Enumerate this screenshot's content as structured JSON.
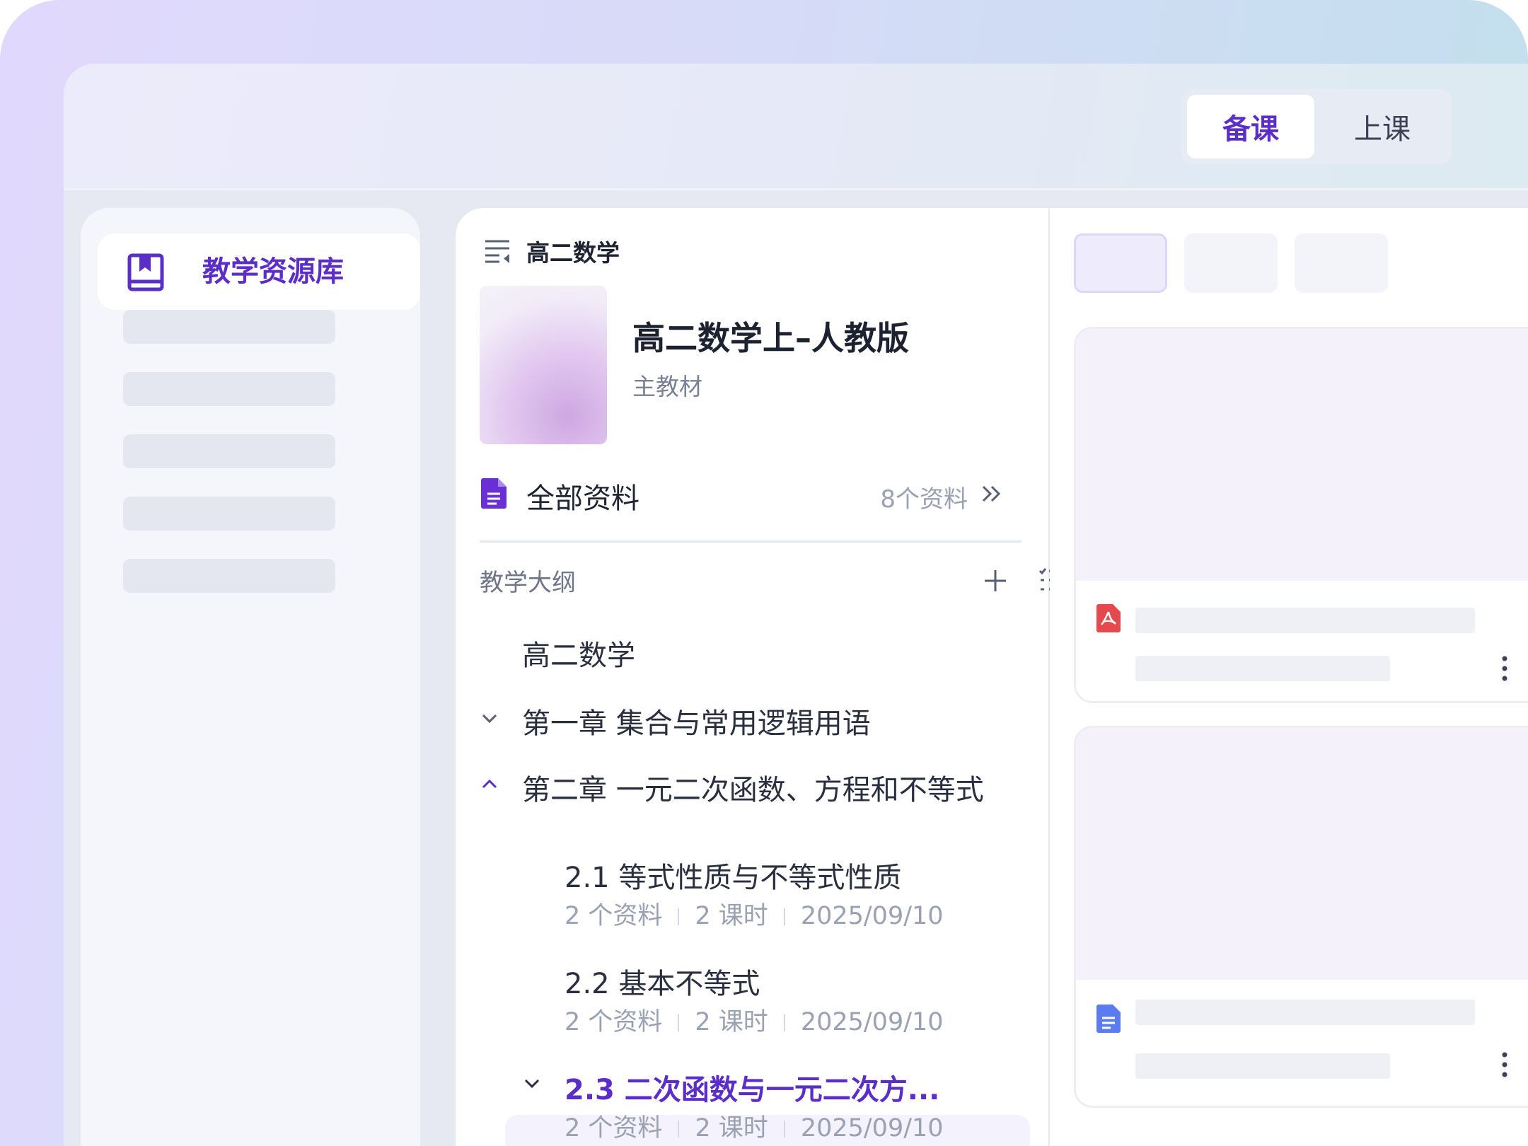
{
  "header": {
    "tabs": [
      {
        "label": "备课",
        "active": true
      },
      {
        "label": "上课",
        "active": false
      }
    ]
  },
  "sidebar": {
    "active_item": {
      "label": "教学资源库",
      "icon": "book-icon"
    }
  },
  "middle": {
    "subject": "高二数学",
    "book": {
      "title": "高二数学上–人教版",
      "subtitle": "主教材"
    },
    "all_materials": {
      "label": "全部资料",
      "count": "8个资料"
    },
    "outline": {
      "label": "教学大纲",
      "root": "高二数学",
      "chapters": [
        {
          "title": "第一章  集合与常用逻辑用语",
          "expanded": false
        },
        {
          "title": "第二章  一元二次函数、方程和不等式",
          "expanded": true
        }
      ],
      "sections": [
        {
          "title": "2.1 等式性质与不等式性质",
          "materials": "2 个资料",
          "hours": "2 课时",
          "date": "2025/09/10"
        },
        {
          "title": "2.2 基本不等式",
          "materials": "2 个资料",
          "hours": "2 课时",
          "date": "2025/09/10"
        },
        {
          "title": "2.3  二次函数与一元二次方...",
          "materials": "2 个资料",
          "hours": "2 课时",
          "date": "2025/09/10",
          "selected": true
        }
      ]
    }
  },
  "colors": {
    "accent": "#5b2ec7",
    "pdf": "#e5484d",
    "doc": "#5b7cf0"
  }
}
